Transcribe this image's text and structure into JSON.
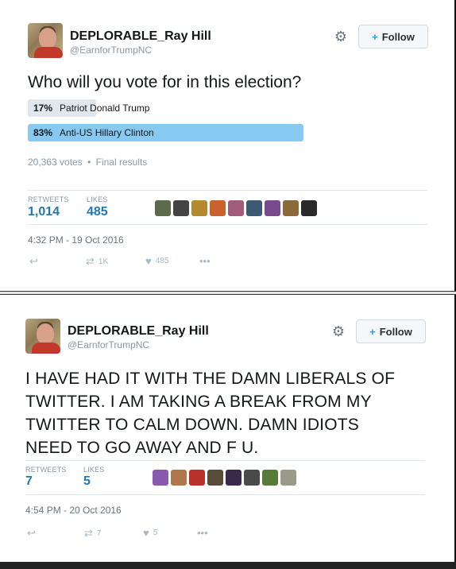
{
  "tweet1": {
    "name": "DEPLORABLE_Ray Hill",
    "handle": "@EarnforTrumpNC",
    "follow_label": "Follow",
    "question": "Who will you vote for in this election?",
    "poll": [
      {
        "pct": "17%",
        "label": "Patriot Donald Trump",
        "fraction": 0.17,
        "color": "#e1e8ed"
      },
      {
        "pct": "83%",
        "label": "Anti-US Hillary Clinton",
        "fraction": 0.83,
        "color": "#88c9f2"
      }
    ],
    "votes": "20,363 votes",
    "results": "Final results",
    "retweets_label": "RETWEETS",
    "retweets": "1,014",
    "likes_label": "LIKES",
    "likes": "485",
    "timestamp": "4:32 PM - 19 Oct 2016",
    "action_retweet_count": "1K",
    "action_like_count": "485",
    "likers": [
      "#5b6b4a",
      "#444444",
      "#b58a2e",
      "#c9622c",
      "#a45a7a",
      "#3d5a73",
      "#7a4a8e",
      "#8a6a3a",
      "#2a2a2a"
    ]
  },
  "tweet2": {
    "name": "DEPLORABLE_Ray Hill",
    "handle": "@EarnforTrumpNC",
    "follow_label": "Follow",
    "text_lines": [
      "I HAVE HAD IT WITH THE DAMN LIBERALS OF",
      "TWITTER.  I AM TAKING A BREAK FROM MY",
      "TWITTER TO CALM DOWN.  DAMN IDIOTS",
      "NEED TO GO AWAY AND F U."
    ],
    "retweets_label": "RETWEETS",
    "retweets": "7",
    "likes_label": "LIKES",
    "likes": "5",
    "timestamp": "4:54 PM - 20 Oct 2016",
    "action_retweet_count": "7",
    "action_like_count": "5",
    "likers": [
      "#8a5ab0",
      "#b0784a",
      "#b8312b",
      "#5a4a3a",
      "#3a2a4a",
      "#4a4a4a",
      "#5a7a3a",
      "#9a9a8a"
    ]
  },
  "icons": {
    "gear": "⚙",
    "reply": "↩",
    "retweet": "⇄",
    "like": "♥",
    "more": "•••",
    "follow_person": "👤+"
  }
}
